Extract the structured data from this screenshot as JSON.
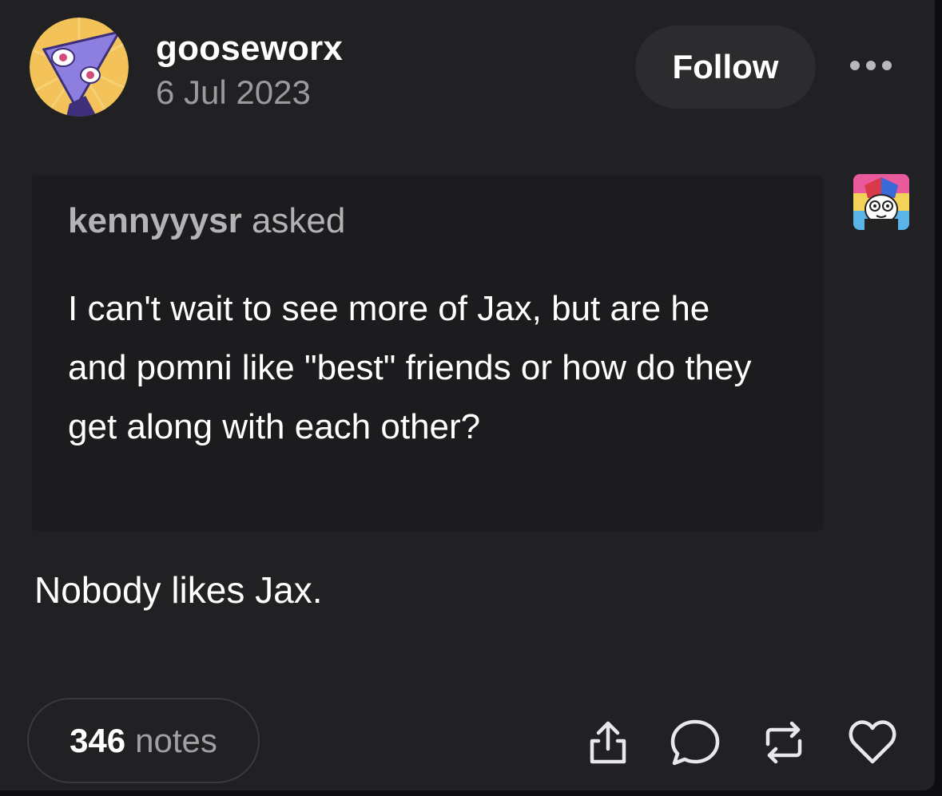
{
  "post": {
    "author": {
      "username": "gooseworx",
      "date": "6 Jul 2023",
      "avatar_icon": "triangle-character-avatar-icon"
    },
    "follow_label": "Follow",
    "more_icon": "more-dots-icon",
    "ask": {
      "asker": "kennyyysr",
      "asked_label": "asked",
      "question": "I can't wait to see more of Jax, but are he and pomni like \"best\" friends or how do they get along with each other?",
      "asker_avatar_icon": "jester-character-avatar-icon"
    },
    "answer": "Nobody likes Jax.",
    "footer": {
      "notes_count": "346",
      "notes_label": "notes",
      "actions": [
        "share-icon",
        "comment-icon",
        "reblog-icon",
        "like-icon"
      ]
    }
  },
  "colors": {
    "background": "#212123",
    "text_primary": "#ffffff",
    "text_secondary": "#9b9b9d",
    "ask_box": "#1c1c1e",
    "button": "#2c2c2e"
  }
}
